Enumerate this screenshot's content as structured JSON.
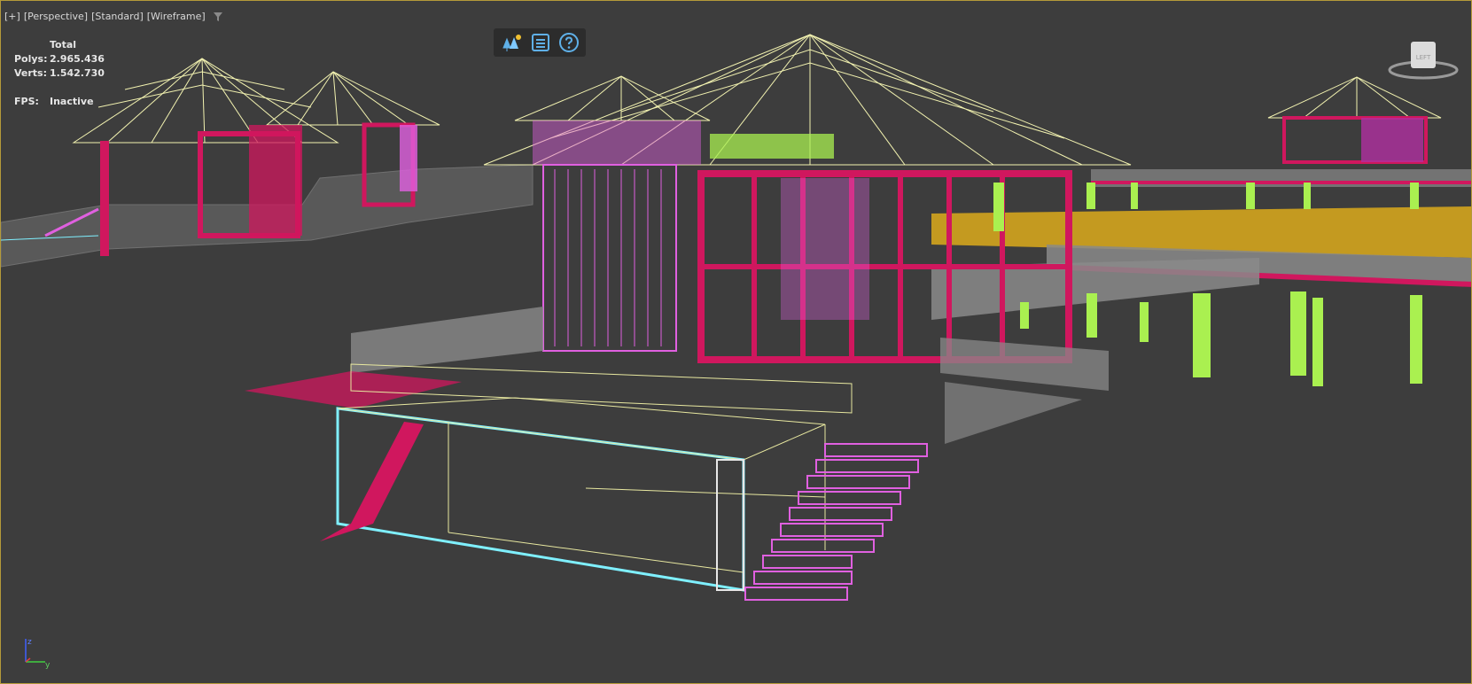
{
  "viewport": {
    "labels": [
      "[+]",
      "[Perspective]",
      "[Standard]",
      "[Wireframe]"
    ],
    "filter_icon": "funnel-icon"
  },
  "stats": {
    "total_label": "Total",
    "polys_label": "Polys:",
    "polys_value": "2.965.436",
    "verts_label": "Verts:",
    "verts_value": "1.542.730",
    "fps_label": "FPS:",
    "fps_value": "Inactive"
  },
  "toolbar": {
    "icons": [
      "trees-icon",
      "list-icon",
      "help-icon"
    ]
  },
  "viewcube": {
    "label": "LEFT"
  },
  "axis": {
    "z": "z",
    "y": "y"
  },
  "colors": {
    "background": "#3d3d3d",
    "border": "#b59a3a",
    "roof": "#f2f2b0",
    "magenta": "#d0175e",
    "pink": "#e060e0",
    "green": "#aaf050",
    "gold": "#c49a20",
    "cyan": "#7ff0ff",
    "grey": "#8a8a8a"
  }
}
